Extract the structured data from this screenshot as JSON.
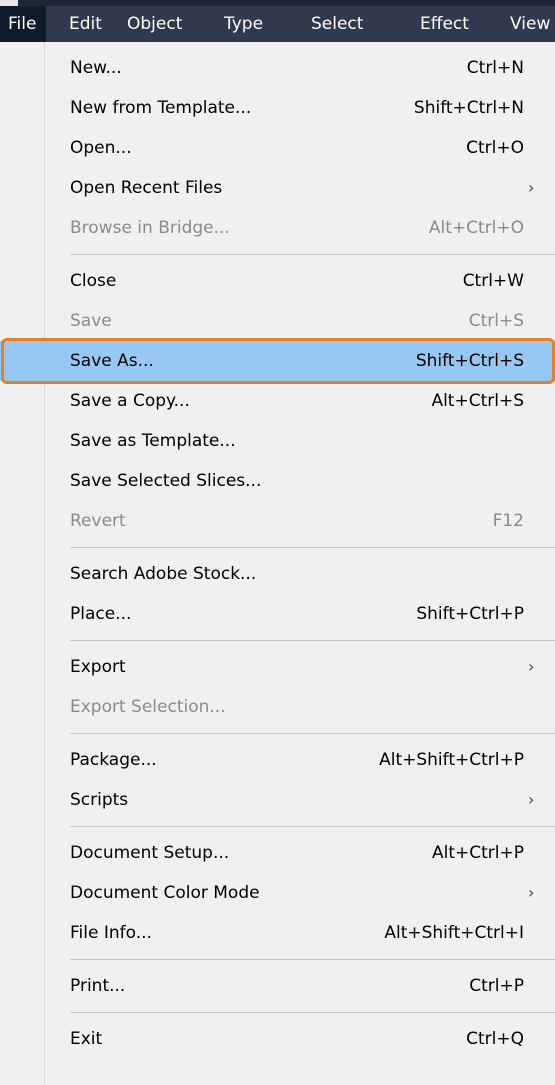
{
  "menubar": {
    "items": [
      {
        "label": "File"
      },
      {
        "label": "Edit"
      },
      {
        "label": "Object"
      },
      {
        "label": "Type"
      },
      {
        "label": "Select"
      },
      {
        "label": "Effect"
      },
      {
        "label": "View"
      }
    ]
  },
  "menu": {
    "items": [
      {
        "label": "New...",
        "shortcut": "Ctrl+N"
      },
      {
        "label": "New from Template...",
        "shortcut": "Shift+Ctrl+N"
      },
      {
        "label": "Open...",
        "shortcut": "Ctrl+O"
      },
      {
        "label": "Open Recent Files",
        "submenu": true
      },
      {
        "label": "Browse in Bridge...",
        "shortcut": "Alt+Ctrl+O",
        "disabled": true
      },
      {
        "label": "Close",
        "shortcut": "Ctrl+W"
      },
      {
        "label": "Save",
        "shortcut": "Ctrl+S",
        "disabled": true
      },
      {
        "label": "Save As...",
        "shortcut": "Shift+Ctrl+S",
        "highlighted": true
      },
      {
        "label": "Save a Copy...",
        "shortcut": "Alt+Ctrl+S"
      },
      {
        "label": "Save as Template..."
      },
      {
        "label": "Save Selected Slices..."
      },
      {
        "label": "Revert",
        "shortcut": "F12",
        "disabled": true
      },
      {
        "label": "Search Adobe Stock..."
      },
      {
        "label": "Place...",
        "shortcut": "Shift+Ctrl+P"
      },
      {
        "label": "Export",
        "submenu": true
      },
      {
        "label": "Export Selection...",
        "disabled": true
      },
      {
        "label": "Package...",
        "shortcut": "Alt+Shift+Ctrl+P"
      },
      {
        "label": "Scripts",
        "submenu": true
      },
      {
        "label": "Document Setup...",
        "shortcut": "Alt+Ctrl+P"
      },
      {
        "label": "Document Color Mode",
        "submenu": true
      },
      {
        "label": "File Info...",
        "shortcut": "Alt+Shift+Ctrl+I"
      },
      {
        "label": "Print...",
        "shortcut": "Ctrl+P"
      },
      {
        "label": "Exit",
        "shortcut": "Ctrl+Q"
      }
    ]
  },
  "colors": {
    "menubar_bg": "#313a4d",
    "menu_bg": "#f0f0f0",
    "highlight": "#97c8f3",
    "callout_outline": "#e67e22",
    "disabled_text": "#8a8a8a"
  },
  "icons": {
    "submenu": "chevron-right-icon"
  }
}
